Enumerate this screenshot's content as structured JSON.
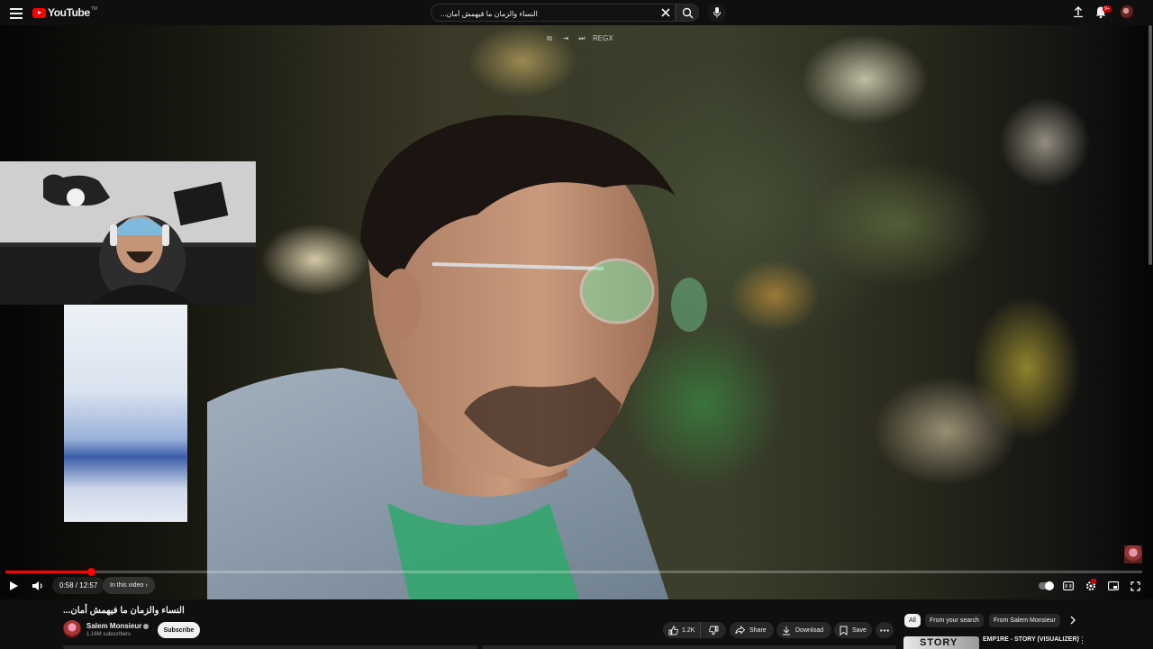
{
  "masthead": {
    "logo_text": "YouTube",
    "logo_tm": "TM",
    "search_value": "...النساء والزمان ما فيهمش أمان",
    "notification_count": "9+"
  },
  "player": {
    "overlay_tag": "REGX",
    "current_time": "0:58",
    "duration": "12:57",
    "time_separator": " / ",
    "progress_fraction": 0.075,
    "chapter_label": "In this video",
    "played_color": "#ff0000"
  },
  "video": {
    "title": "...النساء والزمان ما فيهمش أمان",
    "channel_name": "Salem Monsieur",
    "subscribers": "1.16M subscribers",
    "subscribe_label": "Subscribe",
    "likes": "1.2K",
    "share_label": "Share",
    "download_label": "Download",
    "save_label": "Save"
  },
  "recommendations": {
    "chips": [
      "All",
      "From your search",
      "From Salem Monsieur"
    ],
    "first_title": "EMP1RE - STORY (VISUALIZER)",
    "first_thumb_text": "STORY"
  },
  "icons": {
    "menu": "hamburger-icon",
    "search": "search-icon",
    "mic": "mic-icon",
    "upload": "upload-icon",
    "bell": "bell-icon",
    "play": "play-icon",
    "volume": "volume-icon",
    "autoplay": "autoplay-toggle",
    "captions": "captions-icon",
    "settings": "settings-icon",
    "miniplayer": "miniplayer-icon",
    "fullscreen": "fullscreen-icon"
  }
}
